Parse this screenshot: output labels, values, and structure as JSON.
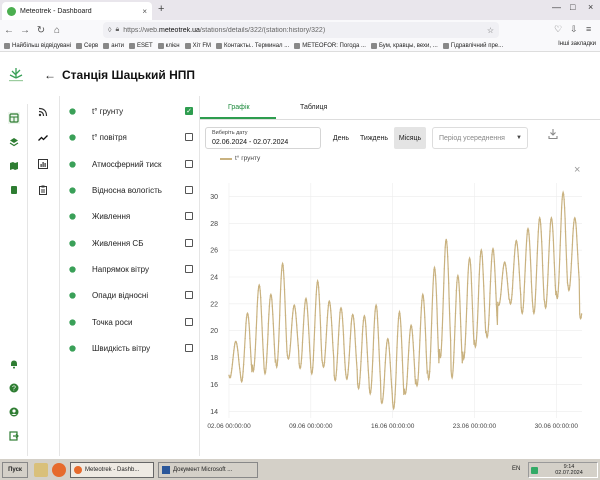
{
  "browser": {
    "tab_title": "Meteotrek - Dashboard",
    "url_prefix": "https://web.",
    "url_domain": "meteotrek.ua",
    "url_path": "/stations/details/322/(station:history/322)",
    "bookmarks": [
      "Найбільш відвідувані",
      "Серв",
      "анти",
      "ESET",
      "клієн",
      "Хіт FM",
      "Контакты.. Терминал ...",
      "METEOFOR: Погода ...",
      "Бум, кравцы, вехи, ...",
      "Гідравлічний пре..."
    ],
    "other_bookmarks": "Інші закладки"
  },
  "page": {
    "title": "Станція Шацький НПП",
    "back_icon": "arrow-left-icon"
  },
  "rail": {
    "top_icons": [
      "dashboard-icon",
      "layers-icon",
      "map-icon",
      "book-icon"
    ],
    "bottom_icons": [
      "bell-icon",
      "help-icon",
      "user-icon",
      "logout-icon"
    ]
  },
  "subrail": {
    "icons": [
      "rss-icon",
      "trend-icon",
      "bar-chart-icon",
      "clipboard-icon"
    ]
  },
  "parameters": [
    {
      "label": "t° грунту",
      "icon": "soil-temp-icon",
      "checked": true
    },
    {
      "label": "t° повітря",
      "icon": "air-temp-icon",
      "checked": false
    },
    {
      "label": "Атмосферний тиск",
      "icon": "pressure-icon",
      "checked": false
    },
    {
      "label": "Відносна вологість",
      "icon": "humidity-icon",
      "checked": false
    },
    {
      "label": "Живлення",
      "icon": "battery-icon",
      "checked": false
    },
    {
      "label": "Живлення СБ",
      "icon": "solar-battery-icon",
      "checked": false
    },
    {
      "label": "Напрямок вітру",
      "icon": "wind-direction-icon",
      "checked": false
    },
    {
      "label": "Опади відносні",
      "icon": "precipitation-icon",
      "checked": false
    },
    {
      "label": "Точка роси",
      "icon": "dew-point-icon",
      "checked": false
    },
    {
      "label": "Швидкість вітру",
      "icon": "wind-speed-icon",
      "checked": false
    }
  ],
  "view_tabs": {
    "graph": "Графік",
    "table": "Таблиця"
  },
  "controls": {
    "date_label": "Виберіть дату",
    "date_value": "02.06.2024 - 02.07.2024",
    "day": "День",
    "week": "Тиждень",
    "month": "Місяць",
    "period_placeholder": "Період усереднення"
  },
  "colors": {
    "accent": "#2e9d4f",
    "series": "#c9b280"
  },
  "chart_data": {
    "type": "line",
    "series_name": "t° грунту",
    "x_ticks": [
      "02.06 00:00:00",
      "09.06 00:00:00",
      "16.06 00:00:00",
      "23.06 00:00:00",
      "30.06 00:00:00"
    ],
    "y_ticks": [
      14,
      16,
      18,
      20,
      22,
      24,
      26,
      28,
      30
    ],
    "ylim": [
      13.5,
      31
    ],
    "x_range_days": [
      0,
      30.2
    ],
    "grid": true,
    "legend": "top-left",
    "daily_min_max": [
      [
        16.5,
        19.2
      ],
      [
        16.2,
        21.3
      ],
      [
        17.0,
        23.4
      ],
      [
        16.8,
        22.7
      ],
      [
        17.3,
        25.0
      ],
      [
        17.9,
        21.9
      ],
      [
        17.2,
        22.4
      ],
      [
        16.8,
        23.7
      ],
      [
        17.3,
        22.2
      ],
      [
        16.3,
        21.7
      ],
      [
        16.4,
        21.2
      ],
      [
        15.7,
        21.1
      ],
      [
        15.3,
        21.9
      ],
      [
        14.6,
        19.4
      ],
      [
        14.2,
        21.4
      ],
      [
        15.3,
        20.4
      ],
      [
        15.9,
        22.7
      ],
      [
        16.4,
        24.7
      ],
      [
        18.0,
        26.8
      ],
      [
        16.5,
        24.1
      ],
      [
        17.9,
        25.4
      ],
      [
        18.8,
        26.0
      ],
      [
        19.5,
        26.1
      ],
      [
        21.9,
        25.1
      ],
      [
        22.0,
        26.7
      ],
      [
        21.3,
        27.6
      ],
      [
        21.3,
        28.4
      ],
      [
        21.7,
        28.4
      ],
      [
        22.4,
        30.3
      ],
      [
        23.0,
        28.4
      ],
      [
        20.9,
        26.0
      ]
    ]
  },
  "taskbar": {
    "start": "Пуск",
    "tasks": [
      "Meteotrek - Dashb...",
      "Документ Microsoft ..."
    ],
    "lang": "EN",
    "time": "9:14",
    "date": "02.07.2024"
  }
}
